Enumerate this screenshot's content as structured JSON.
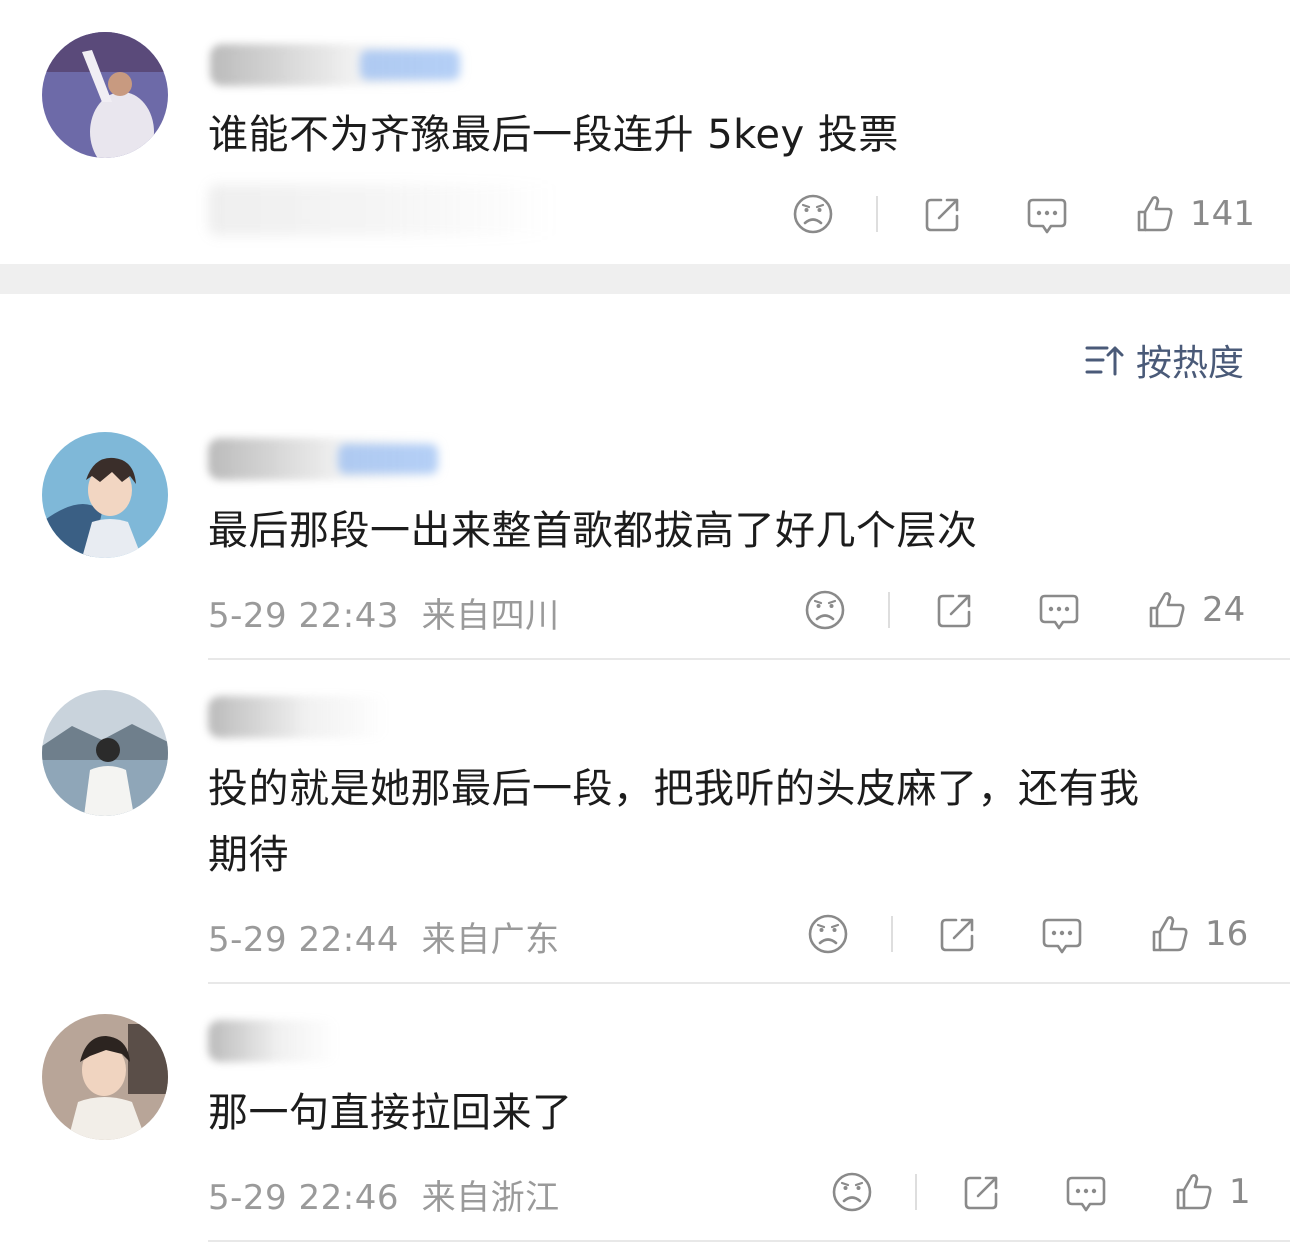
{
  "post": {
    "text": "谁能不为齐豫最后一段连升 5key 投票",
    "dislike_icon": "sad-face-icon",
    "share_icon": "share-icon",
    "comment_icon": "comment-icon",
    "like_icon": "thumbs-up-icon",
    "like_count": "141"
  },
  "sort": {
    "icon": "sort-icon",
    "label": "按热度"
  },
  "comments": [
    {
      "text_lines": [
        "最后那段一出来整首歌都拔高了好几个层次"
      ],
      "time": "5-29 22:43",
      "location": "来自四川",
      "like_count": "24"
    },
    {
      "text_lines": [
        "投的就是她那最后一段，把我听的头皮麻了，还有我",
        "期待"
      ],
      "time": "5-29 22:44",
      "location": "来自广东",
      "like_count": "16"
    },
    {
      "text_lines": [
        "那一句直接拉回来了"
      ],
      "time": "5-29 22:46",
      "location": "来自浙江",
      "like_count": "1"
    }
  ],
  "colors": {
    "text": "#1c1c1c",
    "meta": "#9a9a9a",
    "sort": "#4a5a78",
    "section_gap": "#efefef"
  }
}
